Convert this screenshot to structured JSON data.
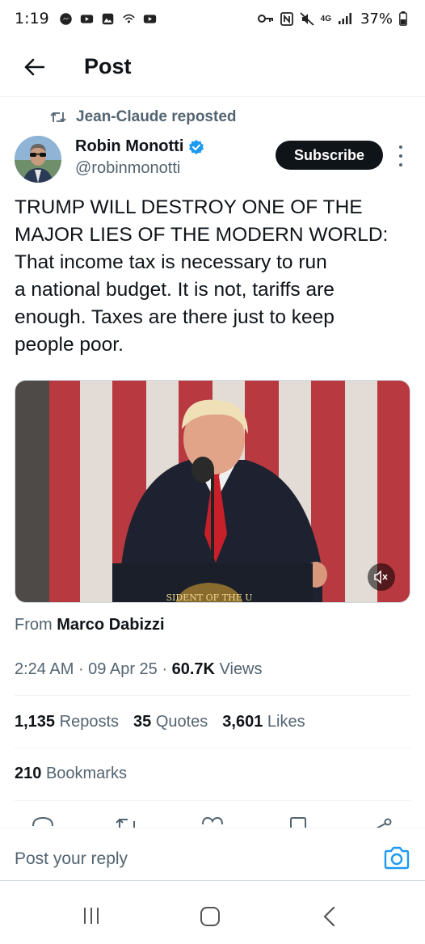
{
  "status_bar": {
    "time": "1:19",
    "network_label": "4G",
    "battery": "37%"
  },
  "header": {
    "title": "Post"
  },
  "repost": {
    "label": "Jean-Claude reposted"
  },
  "author": {
    "name": "Robin Monotti",
    "handle": "@robinmonotti",
    "verified": true
  },
  "subscribe_label": "Subscribe",
  "post": {
    "text": "TRUMP WILL DESTROY ONE OF THE\nMAJOR LIES OF THE MODERN WORLD:\nThat income tax is necessary to run\na national budget. It is not, tariffs are\nenough. Taxes are there just to keep\npeople poor."
  },
  "media": {
    "type": "video",
    "podium_text": "SIDENT OF THE U"
  },
  "from": {
    "prefix": "From",
    "name": "Marco Dabizzi"
  },
  "meta": {
    "time": "2:24 AM",
    "date": "09 Apr 25",
    "views_count": "60.7K",
    "views_label": "Views"
  },
  "stats": {
    "reposts_count": "1,135",
    "reposts_label": "Reposts",
    "quotes_count": "35",
    "quotes_label": "Quotes",
    "likes_count": "3,601",
    "likes_label": "Likes",
    "bookmarks_count": "210",
    "bookmarks_label": "Bookmarks"
  },
  "reply": {
    "placeholder": "Post your reply"
  },
  "colors": {
    "text_primary": "#0f1419",
    "text_secondary": "#536471",
    "accent": "#1d9bf0",
    "divider": "#eff3f4"
  },
  "icons": [
    "back-arrow-icon",
    "repost-icon",
    "verified-badge-icon",
    "more-icon",
    "mute-icon",
    "camera-icon",
    "recents-icon",
    "home-icon",
    "back-icon"
  ]
}
